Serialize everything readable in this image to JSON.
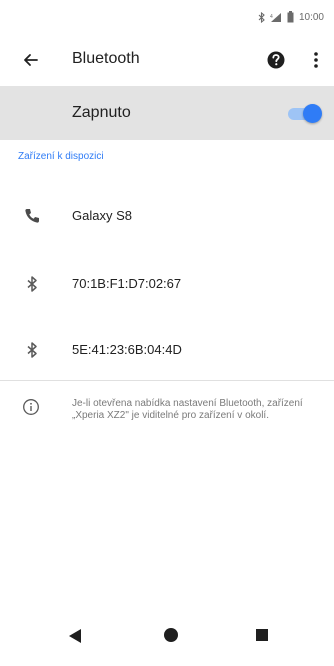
{
  "status_bar": {
    "time": "10:00",
    "icons": [
      "bluetooth-icon",
      "wifi-signal-icon",
      "cell-signal-icon",
      "battery-icon"
    ]
  },
  "app_bar": {
    "title": "Bluetooth",
    "icons": [
      "back-arrow-icon",
      "help-icon",
      "more-vert-icon"
    ]
  },
  "toggle": {
    "label": "Zapnuto",
    "state": "on",
    "accent_color": "#2f7cf6"
  },
  "available_section": {
    "header": "Zařízení k dispozici",
    "devices": [
      {
        "name": "Galaxy S8",
        "icon": "phone-icon"
      },
      {
        "name": "70:1B:F1:D7:02:67",
        "icon": "bluetooth-icon"
      },
      {
        "name": "5E:41:23:6B:04:4D",
        "icon": "bluetooth-icon"
      }
    ]
  },
  "info": {
    "icon": "info-icon",
    "text": "Je-li otevřena nabídka nastavení Bluetooth, zařízení „Xperia XZ2\" je viditelné pro zařízení v okolí."
  },
  "nav_bar": {
    "icons": [
      "nav-back-icon",
      "nav-home-icon",
      "nav-recents-icon"
    ]
  }
}
